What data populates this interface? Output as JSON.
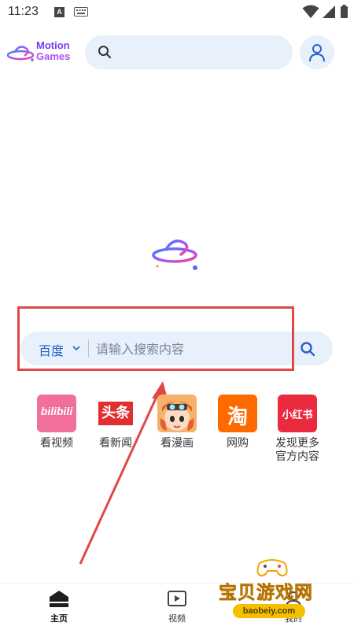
{
  "status_bar": {
    "time": "11:23",
    "notification_letter": "A"
  },
  "header": {
    "logo_line1": "Motion",
    "logo_line2": "Games",
    "search_placeholder": ""
  },
  "search": {
    "engine": "百度",
    "placeholder": "请输入搜索内容"
  },
  "shortcuts": [
    {
      "label": "看视频",
      "tile_text": "bilibili",
      "icon": "bilibili-icon",
      "color": "#f06f9b"
    },
    {
      "label": "看新闻",
      "tile_text": "头条",
      "icon": "toutiao-icon",
      "color": "#e02f2f"
    },
    {
      "label": "看漫画",
      "tile_text": "",
      "icon": "manga-icon",
      "color": "#f6b26b"
    },
    {
      "label": "网购",
      "tile_text": "淘",
      "icon": "taobao-icon",
      "color": "#ff6a00"
    },
    {
      "label": "发现更多\n官方内容",
      "tile_text": "小红书",
      "icon": "xiaohongshu-icon",
      "color": "#ea2a3f"
    }
  ],
  "bottom_nav": [
    {
      "label": "主页",
      "icon": "home-icon",
      "active": true
    },
    {
      "label": "视频",
      "icon": "video-icon",
      "active": false
    },
    {
      "label": "我的",
      "icon": "profile-icon",
      "active": false
    }
  ],
  "watermark": {
    "title": "宝贝游戏网",
    "url": "baobeiy.com"
  },
  "colors": {
    "accent": "#2563c9",
    "search_bg": "#e8f0fb",
    "annotation": "#e04848"
  }
}
